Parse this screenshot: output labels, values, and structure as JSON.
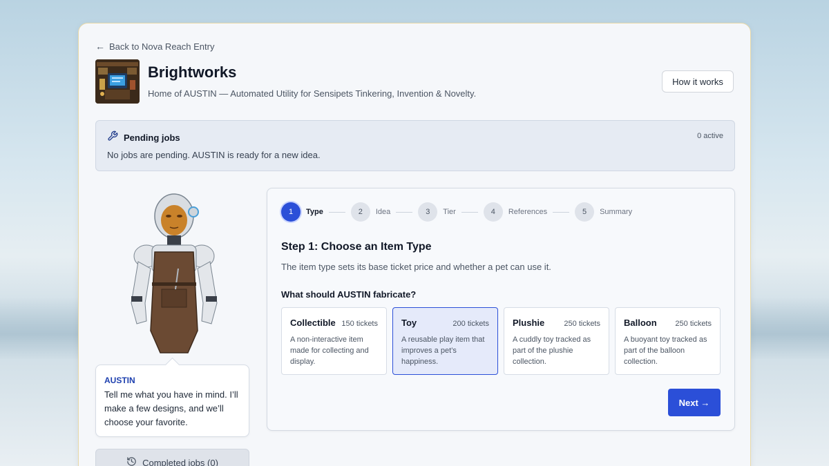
{
  "back_link": "Back to Nova Reach Entry",
  "shop": {
    "name": "Brightworks",
    "subtitle": "Home of AUSTIN — Automated Utility for Sensipets Tinkering, Invention & Novelty."
  },
  "how_it_works": "How it works",
  "pending": {
    "title": "Pending jobs",
    "count": "0 active",
    "message": "No jobs are pending. AUSTIN is ready for a new idea."
  },
  "assistant": {
    "name": "AUSTIN",
    "message": "Tell me what you have in mind. I’ll make a few designs, and we’ll choose your favorite."
  },
  "completed_jobs": "Completed jobs (0)",
  "wizard": {
    "steps": [
      {
        "num": "1",
        "label": "Type"
      },
      {
        "num": "2",
        "label": "Idea"
      },
      {
        "num": "3",
        "label": "Tier"
      },
      {
        "num": "4",
        "label": "References"
      },
      {
        "num": "5",
        "label": "Summary"
      }
    ],
    "active_step": 1,
    "title": "Step 1: Choose an Item Type",
    "subtitle": "The item type sets its base ticket price and whether a pet can use it.",
    "question": "What should AUSTIN fabricate?",
    "options": [
      {
        "name": "Collectible",
        "price": "150 tickets",
        "desc": "A non-interactive item made for collecting and display."
      },
      {
        "name": "Toy",
        "price": "200 tickets",
        "desc": "A reusable play item that improves a pet’s happiness."
      },
      {
        "name": "Plushie",
        "price": "250 tickets",
        "desc": "A cuddly toy tracked as part of the plushie collection."
      },
      {
        "name": "Balloon",
        "price": "250 tickets",
        "desc": "A buoyant toy tracked as part of the balloon collection."
      }
    ],
    "selected_option": "Toy",
    "next": "Next →"
  },
  "colors": {
    "primary": "#2b4fd8",
    "selected_bg": "#e5eafa",
    "card_border": "#e8d9a8"
  }
}
